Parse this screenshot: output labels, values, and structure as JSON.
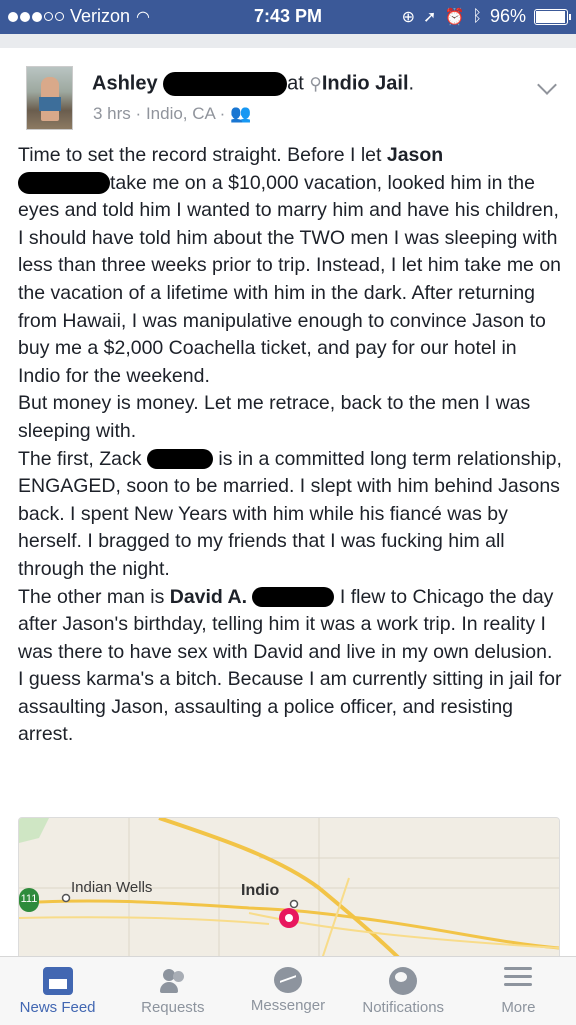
{
  "status_bar": {
    "carrier": "Verizon",
    "time": "7:43 PM",
    "battery": "96%",
    "battery_level": 0.96
  },
  "post": {
    "author_first": "Ashley",
    "at": "at",
    "location": "Indio Jail",
    "location_suffix": ".",
    "time_ago": "3 hrs",
    "place": "Indio, CA",
    "sep": "·",
    "paragraphs": {
      "p1_a": "Time to set the record straight. Before I let ",
      "p1_b": "Jason",
      "p1_c": "take me on a $10,000 vacation, looked him in the eyes and told him I wanted to marry him and have his children, I should have told him about the TWO men I was sleeping with less than three weeks prior to trip. Instead, I let him take me on the vacation of a lifetime with him in the dark. After returning from Hawaii, I was manipulative enough to convince Jason to buy me a $2,000 Coachella ticket, and pay for our hotel in Indio for the weekend.",
      "p2": "But money is money. Let me retrace, back to the men I was sleeping with.",
      "p3_a": "The first, Zack ",
      "p3_b": " is in a committed long term relationship, ENGAGED, soon to be married. I slept with him behind Jasons back. I spent New Years with him while his fiancé was by herself. I bragged to my friends that I was fucking him all through the night.",
      "p4_a": "The other man is ",
      "p4_b": "David A.",
      "p4_c": " I flew to Chicago the day after Jason's birthday, telling him it was a work trip. In reality I was there to have sex with David and live in my own delusion.",
      "p5": "I guess karma's a bitch. Because I am currently sitting in jail for assaulting Jason, assaulting a police officer, and resisting arrest."
    }
  },
  "map": {
    "label_indian_wells": "Indian Wells",
    "label_indio": "Indio",
    "shield_number": "111"
  },
  "tabs": [
    {
      "label": "News Feed",
      "icon": "news-feed-icon"
    },
    {
      "label": "Requests",
      "icon": "requests-icon"
    },
    {
      "label": "Messenger",
      "icon": "messenger-icon"
    },
    {
      "label": "Notifications",
      "icon": "globe-icon"
    },
    {
      "label": "More",
      "icon": "menu-icon"
    }
  ],
  "colors": {
    "brand": "#3b5998",
    "active_tab": "#4267b2",
    "pin": "#e8175d"
  }
}
